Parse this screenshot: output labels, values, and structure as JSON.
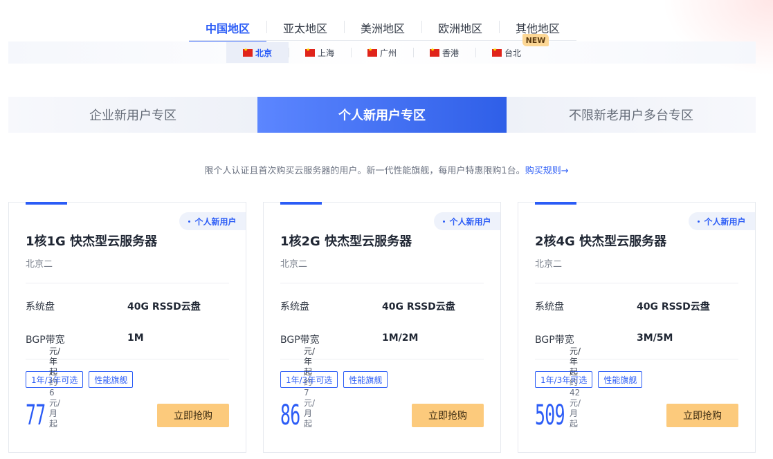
{
  "regions": {
    "tabs": [
      "中国地区",
      "亚太地区",
      "美洲地区",
      "欧洲地区",
      "其他地区"
    ],
    "new_badge": "NEW"
  },
  "cities": [
    "北京",
    "上海",
    "广州",
    "香港",
    "台北"
  ],
  "zones": [
    "企业新用户专区",
    "个人新用户专区",
    "不限新老用户多台专区"
  ],
  "notice": {
    "text": "限个人认证且首次购买云服务器的用户。新一代性能旗舰，每用户特惠限购1台。",
    "link": "购买规则→"
  },
  "cards": [
    {
      "tag": "个人新用户",
      "title": "1核1G 快杰型云服务器",
      "region": "北京二",
      "specs": [
        {
          "label": "系统盘",
          "value": "40G RSSD云盘"
        },
        {
          "label": "BGP带宽",
          "value": "1M"
        }
      ],
      "chips": [
        "1年/3年可选",
        "性能旗舰"
      ],
      "price": "77",
      "price_unit": "元/年起",
      "price_month": "约6元/月起",
      "button": "立即抢购"
    },
    {
      "tag": "个人新用户",
      "title": "1核2G 快杰型云服务器",
      "region": "北京二",
      "specs": [
        {
          "label": "系统盘",
          "value": "40G RSSD云盘"
        },
        {
          "label": "BGP带宽",
          "value": "1M/2M"
        }
      ],
      "chips": [
        "1年/3年可选",
        "性能旗舰"
      ],
      "price": "86",
      "price_unit": "元/年起",
      "price_month": "约7元/月起",
      "button": "立即抢购"
    },
    {
      "tag": "个人新用户",
      "title": "2核4G 快杰型云服务器",
      "region": "北京二",
      "specs": [
        {
          "label": "系统盘",
          "value": "40G RSSD云盘"
        },
        {
          "label": "BGP带宽",
          "value": "3M/5M"
        }
      ],
      "chips": [
        "1年/3年可选",
        "性能旗舰"
      ],
      "price": "509",
      "price_unit": "元/年起",
      "price_month": "约42元/月起",
      "button": "立即抢购"
    }
  ],
  "colors": {
    "accent": "#2b5cf6",
    "button": "#fcca7c",
    "badge": "#fcd795"
  }
}
